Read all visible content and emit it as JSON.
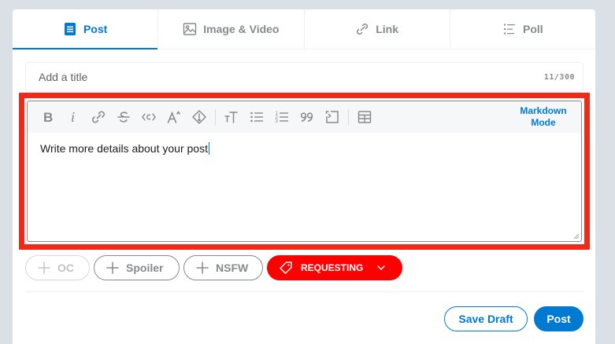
{
  "tabs": [
    {
      "label": "Post",
      "icon": "post-icon",
      "active": true
    },
    {
      "label": "Image & Video",
      "icon": "image-icon",
      "active": false
    },
    {
      "label": "Link",
      "icon": "link-icon",
      "active": false
    },
    {
      "label": "Poll",
      "icon": "poll-icon",
      "active": false
    }
  ],
  "title_field": {
    "placeholder": "Add a title",
    "value": "",
    "counter": "11/300"
  },
  "editor": {
    "toolbar_icons": [
      "bold-icon",
      "italic-icon",
      "link-icon",
      "strikethrough-icon",
      "inline-code-icon",
      "superscript-icon",
      "spoiler-icon",
      "heading-icon",
      "bulleted-list-icon",
      "numbered-list-icon",
      "quote-block-icon",
      "code-block-icon",
      "table-icon"
    ],
    "markdown_mode": "Markdown Mode",
    "body": "Write more details about your post"
  },
  "tags": {
    "oc": "OC",
    "spoiler": "Spoiler",
    "nsfw": "NSFW",
    "flair": "REQUESTING"
  },
  "actions": {
    "save_draft": "Save Draft",
    "post": "Post"
  },
  "colors": {
    "accent": "#0079d3",
    "highlight": "#ee2a18",
    "flair": "#ff0000",
    "page_bg": "#dae0e6"
  }
}
